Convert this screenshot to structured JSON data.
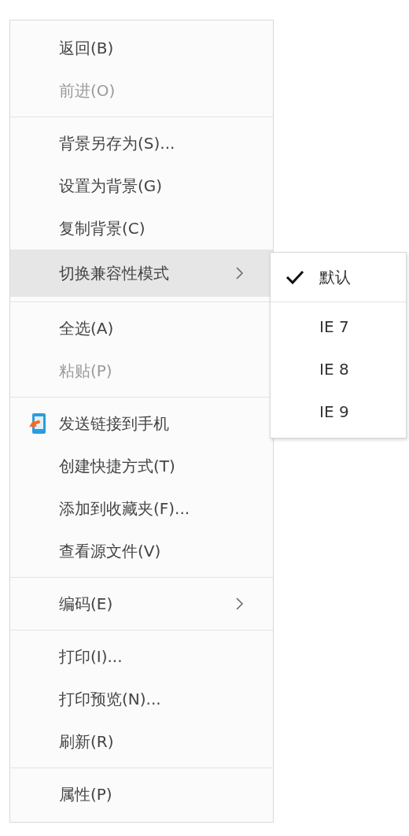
{
  "context_menu": {
    "items": [
      {
        "kind": "item",
        "label": "返回(B)",
        "disabled": false,
        "highlighted": false
      },
      {
        "kind": "item",
        "label": "前进(O)",
        "disabled": true,
        "highlighted": false
      },
      {
        "kind": "separator"
      },
      {
        "kind": "item",
        "label": "背景另存为(S)...",
        "disabled": false,
        "highlighted": false
      },
      {
        "kind": "item",
        "label": "设置为背景(G)",
        "disabled": false,
        "highlighted": false
      },
      {
        "kind": "item",
        "label": "复制背景(C)",
        "disabled": false,
        "highlighted": false
      },
      {
        "kind": "submenu",
        "label": "切换兼容性模式",
        "disabled": false,
        "highlighted": true
      },
      {
        "kind": "separator"
      },
      {
        "kind": "item",
        "label": "全选(A)",
        "disabled": false,
        "highlighted": false
      },
      {
        "kind": "item",
        "label": "粘贴(P)",
        "disabled": true,
        "highlighted": false
      },
      {
        "kind": "separator"
      },
      {
        "kind": "icon_item",
        "label": "发送链接到手机",
        "disabled": false,
        "highlighted": false
      },
      {
        "kind": "item",
        "label": "创建快捷方式(T)",
        "disabled": false,
        "highlighted": false
      },
      {
        "kind": "item",
        "label": "添加到收藏夹(F)...",
        "disabled": false,
        "highlighted": false
      },
      {
        "kind": "item",
        "label": "查看源文件(V)",
        "disabled": false,
        "highlighted": false
      },
      {
        "kind": "separator"
      },
      {
        "kind": "submenu",
        "label": "编码(E)",
        "disabled": false,
        "highlighted": false
      },
      {
        "kind": "separator"
      },
      {
        "kind": "item",
        "label": "打印(I)...",
        "disabled": false,
        "highlighted": false
      },
      {
        "kind": "item",
        "label": "打印预览(N)...",
        "disabled": false,
        "highlighted": false
      },
      {
        "kind": "item",
        "label": "刷新(R)",
        "disabled": false,
        "highlighted": false
      },
      {
        "kind": "separator"
      },
      {
        "kind": "item",
        "label": "属性(P)",
        "disabled": false,
        "highlighted": false
      }
    ]
  },
  "submenu": {
    "items": [
      {
        "kind": "item",
        "label": "默认",
        "checked": true
      },
      {
        "kind": "separator"
      },
      {
        "kind": "item",
        "label": "IE 7",
        "checked": false
      },
      {
        "kind": "item",
        "label": "IE 8",
        "checked": false
      },
      {
        "kind": "item",
        "label": "IE 9",
        "checked": false
      }
    ]
  }
}
